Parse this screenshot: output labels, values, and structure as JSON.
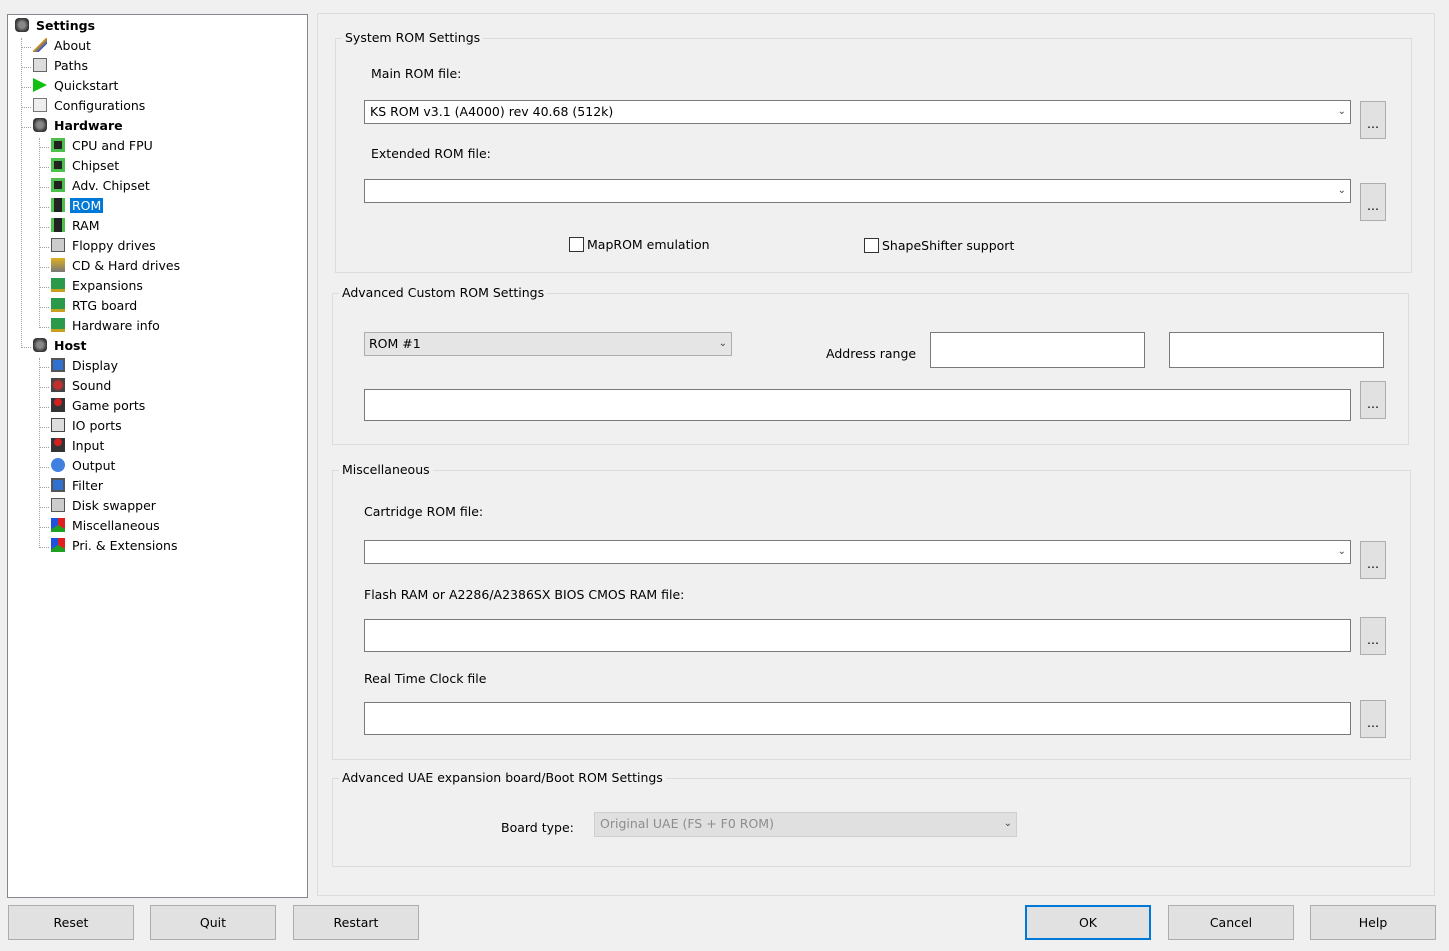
{
  "tree": {
    "items": [
      {
        "label": "Settings",
        "level": 0,
        "bold": true,
        "icon": "disks-icon"
      },
      {
        "label": "About",
        "level": 1,
        "icon": "checkmark-icon"
      },
      {
        "label": "Paths",
        "level": 1,
        "icon": "paths-icon"
      },
      {
        "label": "Quickstart",
        "level": 1,
        "icon": "play-icon"
      },
      {
        "label": "Configurations",
        "level": 1,
        "icon": "config-icon"
      },
      {
        "label": "Hardware",
        "level": 1,
        "bold": true,
        "icon": "disks-icon"
      },
      {
        "label": "CPU and FPU",
        "level": 2,
        "icon": "chip-icon"
      },
      {
        "label": "Chipset",
        "level": 2,
        "icon": "chip-icon"
      },
      {
        "label": "Adv. Chipset",
        "level": 2,
        "icon": "chip-icon"
      },
      {
        "label": "ROM",
        "level": 2,
        "icon": "rom-chip-icon",
        "selected": true
      },
      {
        "label": "RAM",
        "level": 2,
        "icon": "ram-chip-icon"
      },
      {
        "label": "Floppy drives",
        "level": 2,
        "icon": "floppy-icon"
      },
      {
        "label": "CD & Hard drives",
        "level": 2,
        "icon": "harddrive-icon"
      },
      {
        "label": "Expansions",
        "level": 2,
        "icon": "card-icon"
      },
      {
        "label": "RTG board",
        "level": 2,
        "icon": "card-icon"
      },
      {
        "label": "Hardware info",
        "level": 2,
        "icon": "card-icon"
      },
      {
        "label": "Host",
        "level": 1,
        "bold": true,
        "icon": "disks-icon"
      },
      {
        "label": "Display",
        "level": 2,
        "icon": "monitor-icon"
      },
      {
        "label": "Sound",
        "level": 2,
        "icon": "speaker-icon"
      },
      {
        "label": "Game ports",
        "level": 2,
        "icon": "joystick-icon"
      },
      {
        "label": "IO ports",
        "level": 2,
        "icon": "port-icon"
      },
      {
        "label": "Input",
        "level": 2,
        "icon": "joystick-icon"
      },
      {
        "label": "Output",
        "level": 2,
        "icon": "output-icon"
      },
      {
        "label": "Filter",
        "level": 2,
        "icon": "monitor-icon"
      },
      {
        "label": "Disk swapper",
        "level": 2,
        "icon": "floppy-icon"
      },
      {
        "label": "Miscellaneous",
        "level": 2,
        "icon": "misc-icon"
      },
      {
        "label": "Pri. & Extensions",
        "level": 2,
        "icon": "misc-icon"
      }
    ]
  },
  "system_rom": {
    "title": "System ROM Settings",
    "main_label": "Main ROM file:",
    "main_value": "KS ROM v3.1 (A4000) rev 40.68 (512k)",
    "ext_label": "Extended ROM file:",
    "ext_value": "",
    "maprom": "MapROM emulation",
    "maprom_checked": false,
    "shapeshifter": "ShapeShifter support",
    "shapeshifter_checked": false,
    "browse": "..."
  },
  "custom_rom": {
    "title": "Advanced Custom ROM Settings",
    "rom_select": "ROM #1",
    "address_label": "Address range",
    "addr_start": "",
    "addr_end": "",
    "file": ""
  },
  "misc": {
    "title": "Miscellaneous",
    "cart_label": "Cartridge ROM file:",
    "cart_value": "",
    "flash_label": "Flash RAM or A2286/A2386SX BIOS CMOS RAM file:",
    "flash_value": "",
    "rtc_label": "Real Time Clock file",
    "rtc_value": ""
  },
  "uae_board": {
    "title": "Advanced UAE expansion board/Boot ROM Settings",
    "board_label": "Board type:",
    "board_value": "Original UAE (FS + F0 ROM)"
  },
  "buttons": {
    "reset": "Reset",
    "quit": "Quit",
    "restart": "Restart",
    "ok": "OK",
    "cancel": "Cancel",
    "help": "Help"
  },
  "colors": {
    "selection": "#0078d7",
    "background": "#f0f0f0"
  }
}
